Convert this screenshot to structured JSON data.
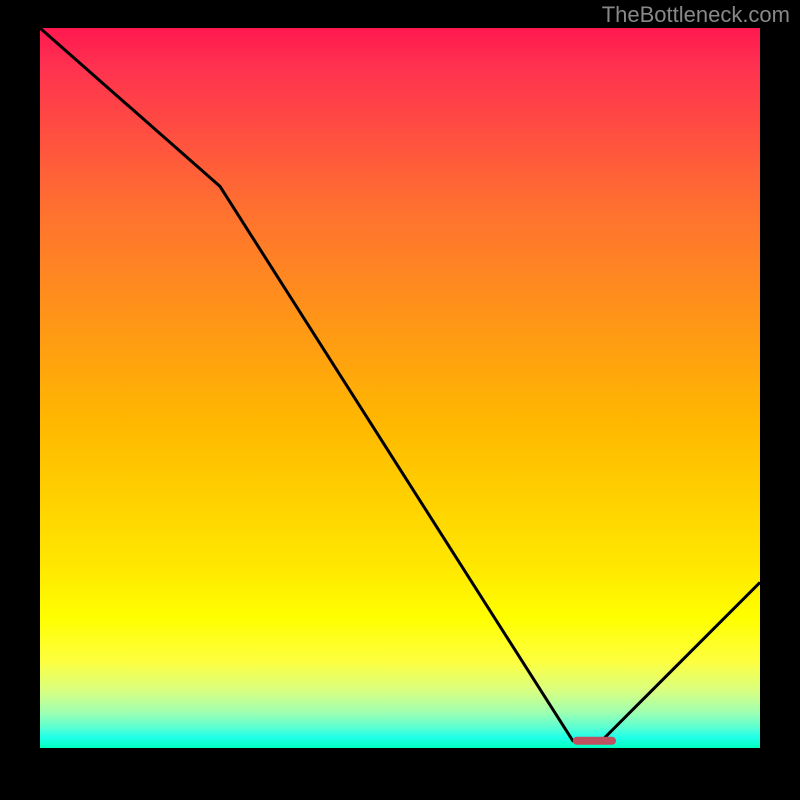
{
  "watermark": "TheBottleneck.com",
  "chart_data": {
    "type": "line",
    "title": "",
    "xlabel": "",
    "ylabel": "",
    "xlim": [
      0,
      100
    ],
    "ylim": [
      0,
      100
    ],
    "x": [
      0,
      25,
      74,
      78,
      100
    ],
    "values": [
      100,
      78,
      1,
      1,
      23
    ],
    "background_gradient": {
      "top": "#ff1850",
      "middle": "#ffff00",
      "bottom": "#00ffc0"
    },
    "marker": {
      "x_start": 74,
      "x_end": 80,
      "y": 1,
      "color": "#c05060"
    }
  }
}
